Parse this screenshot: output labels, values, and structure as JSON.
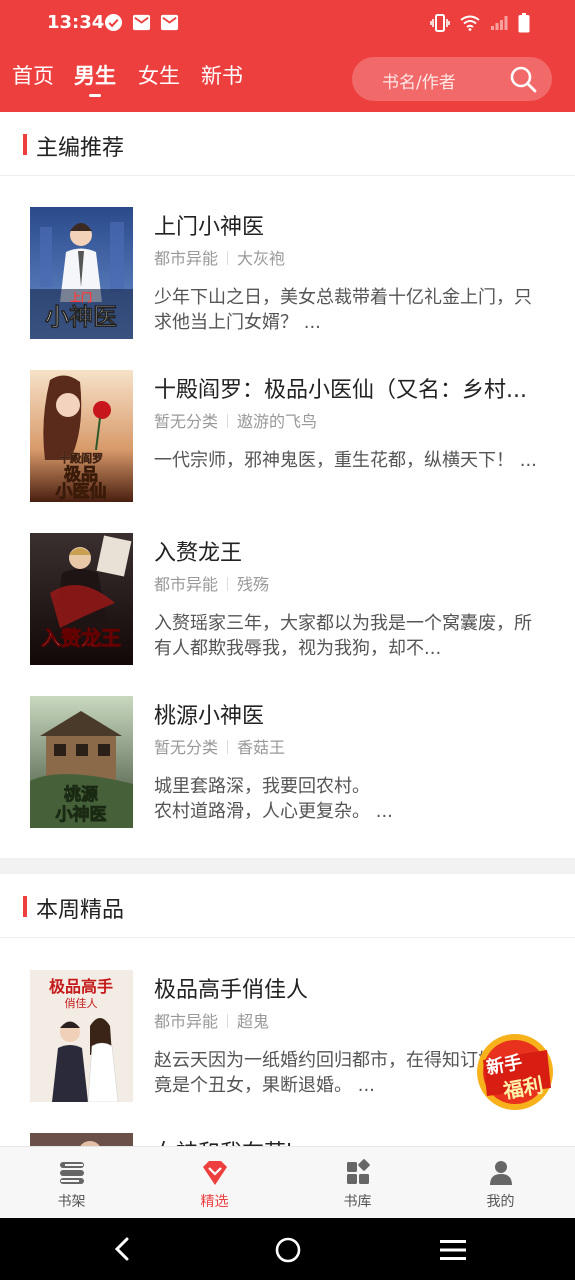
{
  "status_bar": {
    "time": "13:34",
    "left_icons": [
      "check-circle-icon",
      "mail-icon",
      "mail-icon"
    ],
    "right_icons": [
      "vibrate-icon",
      "wifi-icon",
      "signal-icon",
      "battery-icon"
    ]
  },
  "header": {
    "tabs": [
      {
        "label": "首页",
        "active": false
      },
      {
        "label": "男生",
        "active": true
      },
      {
        "label": "女生",
        "active": false
      },
      {
        "label": "新书",
        "active": false
      }
    ],
    "search": {
      "placeholder": "书名/作者",
      "icon": "search-icon"
    },
    "accent_color": "#ee3f3f"
  },
  "sections": [
    {
      "title": "主编推荐",
      "books": [
        {
          "title": "上门小神医",
          "category": "都市异能",
          "author": "大灰袍",
          "description": "少年下山之日，美女总裁带着十亿礼金上门，只求他当上门女婿？ ...",
          "cover_text": "上门小神医"
        },
        {
          "title": "十殿阎罗：极品小医仙（又名：乡村...",
          "category": "暂无分类",
          "author": "遨游的飞鸟",
          "description": "一代宗师，邪神鬼医，重生花都，纵横天下！ ...",
          "cover_text": "极品小医仙"
        },
        {
          "title": "入赘龙王",
          "category": "都市异能",
          "author": "残殇",
          "description": "入赘瑶家三年，大家都以为我是一个窝囊废，所有人都欺我辱我，视为我狗，却不...",
          "cover_text": "入赘龙王"
        },
        {
          "title": "桃源小神医",
          "category": "暂无分类",
          "author": "香菇王",
          "description": "城里套路深，我要回农村。\n农村道路滑，人心更复杂。 ...",
          "cover_text": "桃源小神医"
        }
      ]
    },
    {
      "title": "本周精品",
      "books": [
        {
          "title": "极品高手俏佳人",
          "category": "都市异能",
          "author": "超鬼",
          "description": "赵云天因为一纸婚约回归都市，在得知订婚对象竟是个丑女，果断退婚。 ...",
          "cover_text": "极品高手俏佳人"
        },
        {
          "title": "女神和我在营le",
          "category": "",
          "author": "",
          "description": "",
          "cover_text": ""
        }
      ]
    }
  ],
  "promo_badge": {
    "line1": "新手",
    "line2": "福利"
  },
  "tabbar": [
    {
      "label": "书架",
      "icon": "bookshelf-icon",
      "active": false
    },
    {
      "label": "精选",
      "icon": "diamond-icon",
      "active": true
    },
    {
      "label": "书库",
      "icon": "library-grid-icon",
      "active": false
    },
    {
      "label": "我的",
      "icon": "profile-icon",
      "active": false
    }
  ],
  "system_nav": [
    "back-icon",
    "home-icon",
    "recents-icon"
  ]
}
